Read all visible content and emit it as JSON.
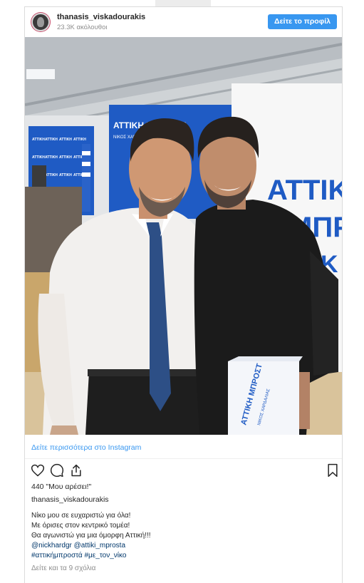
{
  "header": {
    "username": "thanasis_viskadourakis",
    "followers": "23.3K ακόλουθοι",
    "profile_button": "Δείτε το προφίλ"
  },
  "photo": {
    "banner_left": "ΑΤΤΙΚΗ ΜΠΡΟΣΤΑ",
    "banner_left_sub": "ΝΙΚΟΣ ΧΑΡΔΑΛΙΑΣ",
    "banner_right": "ΑΤΤΙΚ",
    "banner_right_2": "ΜΠΡΟ",
    "banner_right_3": "Κ",
    "folder_text": "ΑΤΤΙΚΗ ΜΠΡΟΣΤ",
    "folder_sub": "ΝΙΚΟΣ ΧΑΡΔΑΛΙΑΣ"
  },
  "view_more": "Δείτε περισσότερα στο Instagram",
  "icons": [
    "heart-icon",
    "comment-icon",
    "share-icon",
    "bookmark-icon"
  ],
  "likes": "440 \"Μου αρέσει!\"",
  "caption": {
    "username": "thanasis_viskadourakis",
    "lines": [
      "Νίκο μου σε ευχαριστώ για όλα!",
      "Με όρισες στον κεντρικό τομέα!",
      "Θα αγωνιστώ για μια όμορφη Αττική!!!"
    ],
    "mentions": "@nickhardgr @attiki_mprosta",
    "hashtags": "#αττικήμπροστά #με_τον_νίκο"
  },
  "comments_link": "Δείτε και τα 9 σχόλια",
  "colors": {
    "accent": "#3897f0",
    "link": "#00376b",
    "muted": "#8e8e8e",
    "banner_blue": "#1f5bc4"
  }
}
